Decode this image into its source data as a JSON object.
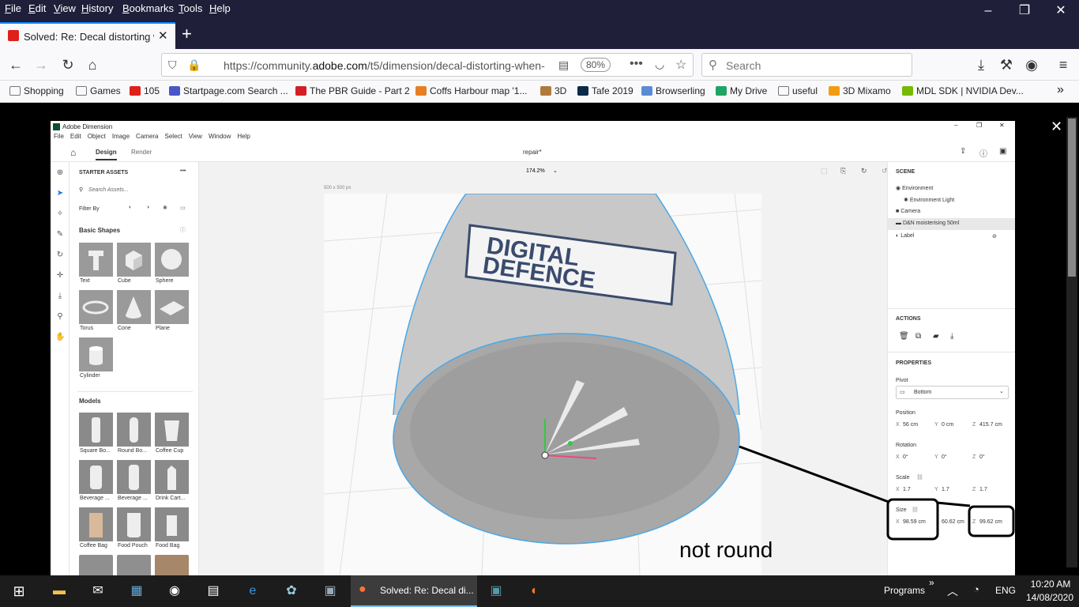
{
  "browser": {
    "menu": [
      "File",
      "Edit",
      "View",
      "History",
      "Bookmarks",
      "Tools",
      "Help"
    ],
    "tab_title": "Solved: Re: Decal distorting wh",
    "url_prefix": "https://community.",
    "url_domain": "adobe.com",
    "url_path": "/t5/dimension/decal-distorting-when-",
    "zoom": "80%",
    "search_placeholder": "Search",
    "bookmarks": [
      "Shopping",
      "Games",
      "105",
      "Startpage.com Search ...",
      "The PBR Guide - Part 2",
      "Coffs Harbour map '1...",
      "3D",
      "Tafe 2019",
      "Browserling",
      "My Drive",
      "useful",
      "3D Mixamo",
      "MDL SDK | NVIDIA Dev..."
    ]
  },
  "dimension": {
    "title": "Adobe Dimension",
    "menu": [
      "File",
      "Edit",
      "Object",
      "Image",
      "Camera",
      "Select",
      "View",
      "Window",
      "Help"
    ],
    "tabs": {
      "design": "Design",
      "render": "Render"
    },
    "doc_name": "repair*",
    "zoom": "174.2%",
    "canvas_size": "500 x 500 px",
    "assets": {
      "header": "STARTER ASSETS",
      "search_placeholder": "Search Assets...",
      "filter_by": "Filter By",
      "basic_shapes_title": "Basic Shapes",
      "basic_shapes": [
        "Text",
        "Cube",
        "Sphere",
        "Torus",
        "Cone",
        "Plane",
        "Cylinder"
      ],
      "models_title": "Models",
      "models": [
        "Square Bo...",
        "Round Bo...",
        "Coffee Cup",
        "Beverage ...",
        "Beverage ...",
        "Drink Cart...",
        "Coffee Bag",
        "Food Pouch",
        "Food Bag"
      ]
    },
    "scene": {
      "title": "SCENE",
      "items": [
        "Environment",
        "Environment Light",
        "Camera",
        "D&N moisterising 50ml",
        "Label"
      ]
    },
    "actions_title": "ACTIONS",
    "properties": {
      "title": "PROPERTIES",
      "pivot_label": "Pivot",
      "pivot_value": "Bottom",
      "position_label": "Position",
      "position": {
        "x": "56 cm",
        "y": "0 cm",
        "z": "415.7 cm"
      },
      "rotation_label": "Rotation",
      "rotation": {
        "x": "0°",
        "y": "0°",
        "z": "0°"
      },
      "scale_label": "Scale",
      "scale": {
        "x": "1.7",
        "y": "1.7",
        "z": "1.7"
      },
      "size_label": "Size",
      "size": {
        "x": "98.59 cm",
        "y": "60.62 cm",
        "z": "99.62 cm"
      }
    },
    "label_text_top": "DIGITAL",
    "label_text_bottom": "DEFENCE"
  },
  "annotation": "not round",
  "taskbar": {
    "active_title": "Solved: Re: Decal di...",
    "programs": "Programs",
    "lang": "ENG",
    "time": "10:20 AM",
    "date": "14/08/2020"
  }
}
